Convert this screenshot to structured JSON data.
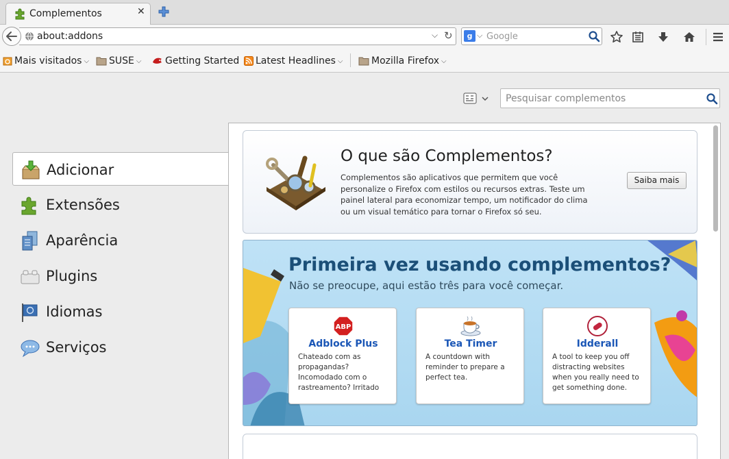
{
  "tab": {
    "title": "Complementos",
    "close_glyph": "✕"
  },
  "navbar": {
    "url": "about:addons",
    "search_placeholder": "Google",
    "search_engine_letter": "g"
  },
  "bookmarks": [
    {
      "label": "Mais visitados",
      "icon": "most-visited-icon"
    },
    {
      "label": "SUSE",
      "icon": "folder-icon"
    },
    {
      "label": "Getting Started",
      "icon": "getting-started-icon"
    },
    {
      "label": "Latest Headlines",
      "icon": "rss-icon"
    },
    {
      "label": "Mozilla Firefox",
      "icon": "folder-icon"
    }
  ],
  "addons_search": {
    "placeholder": "Pesquisar complementos"
  },
  "categories": [
    {
      "label": "Adicionar",
      "icon": "get-addons-icon",
      "selected": true
    },
    {
      "label": "Extensões",
      "icon": "puzzle-icon"
    },
    {
      "label": "Aparência",
      "icon": "appearance-icon"
    },
    {
      "label": "Plugins",
      "icon": "plugin-brick-icon"
    },
    {
      "label": "Idiomas",
      "icon": "language-flag-icon"
    },
    {
      "label": "Serviços",
      "icon": "services-chat-icon"
    }
  ],
  "intro": {
    "heading": "O que são Complementos?",
    "description": "Complementos são aplicativos que permitem que você personalize o Firefox com estilos ou recursos extras. Teste um painel lateral para economizar tempo, um notificador do clima ou um visual temático para tornar o Firefox só seu.",
    "button": "Saiba mais"
  },
  "discover": {
    "heading": "Primeira vez usando complementos?",
    "subheading": "Não se preocupe, aqui estão três para você começar.",
    "addons": [
      {
        "name": "Adblock Plus",
        "icon": "adblock-plus-icon",
        "description": "Chateado com as propagandas? Incomodado com o rastreamento? Irritado c…"
      },
      {
        "name": "Tea Timer",
        "icon": "tea-cup-icon",
        "description": "A countdown with reminder to prepare a perfect tea."
      },
      {
        "name": "Idderall",
        "icon": "pill-icon",
        "description": "A tool to keep you off distracting websites when you really need to get something done. Follow …"
      }
    ]
  },
  "colors": {
    "link_blue": "#1a56b6",
    "discover_heading": "#1b4f78",
    "discover_bg": "#bfe2f6"
  }
}
